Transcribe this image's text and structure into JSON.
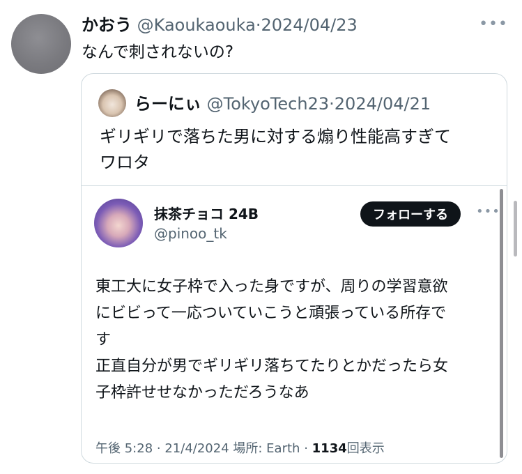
{
  "tweet": {
    "author_name": "かおう",
    "handle": "@Kaoukaouka",
    "separator": "·",
    "date": "2024/04/23",
    "text": "なんで刺されないの?",
    "more_icon": "more-horizontal-icon"
  },
  "quote": {
    "author_name": "らーにぃ",
    "handle": "@TokyoTech23",
    "separator": "·",
    "date": "2024/04/21",
    "text_line1": "ギリギリで落ちた男に対する煽り性能高すぎて",
    "text_line2": "ワロタ"
  },
  "embed": {
    "author_name": "抹茶チョコ 24B",
    "handle": "@pinoo_tk",
    "follow_label": "フォローする",
    "more_icon": "more-horizontal-icon",
    "text_line1": "東工大に女子枠で入った身ですが、周りの学習意欲",
    "text_line2": "にビビって一応ついていこうと頑張っている所存で",
    "text_line3": "す",
    "text_line4": "正直自分が男でギリギリ落ちてたりとかだったら女",
    "text_line5": "子枠許せせなかっただろうなあ",
    "meta_time": "午後 5:28",
    "meta_sep1": "·",
    "meta_date": "21/4/2024",
    "meta_location": "場所: Earth",
    "meta_sep2": "·",
    "meta_views_count": "1134",
    "meta_views_label": "回表示"
  },
  "colors": {
    "text_primary": "#0f1419",
    "text_muted": "#536471",
    "border": "#cfd9de",
    "follow_bg": "#0f1419"
  }
}
